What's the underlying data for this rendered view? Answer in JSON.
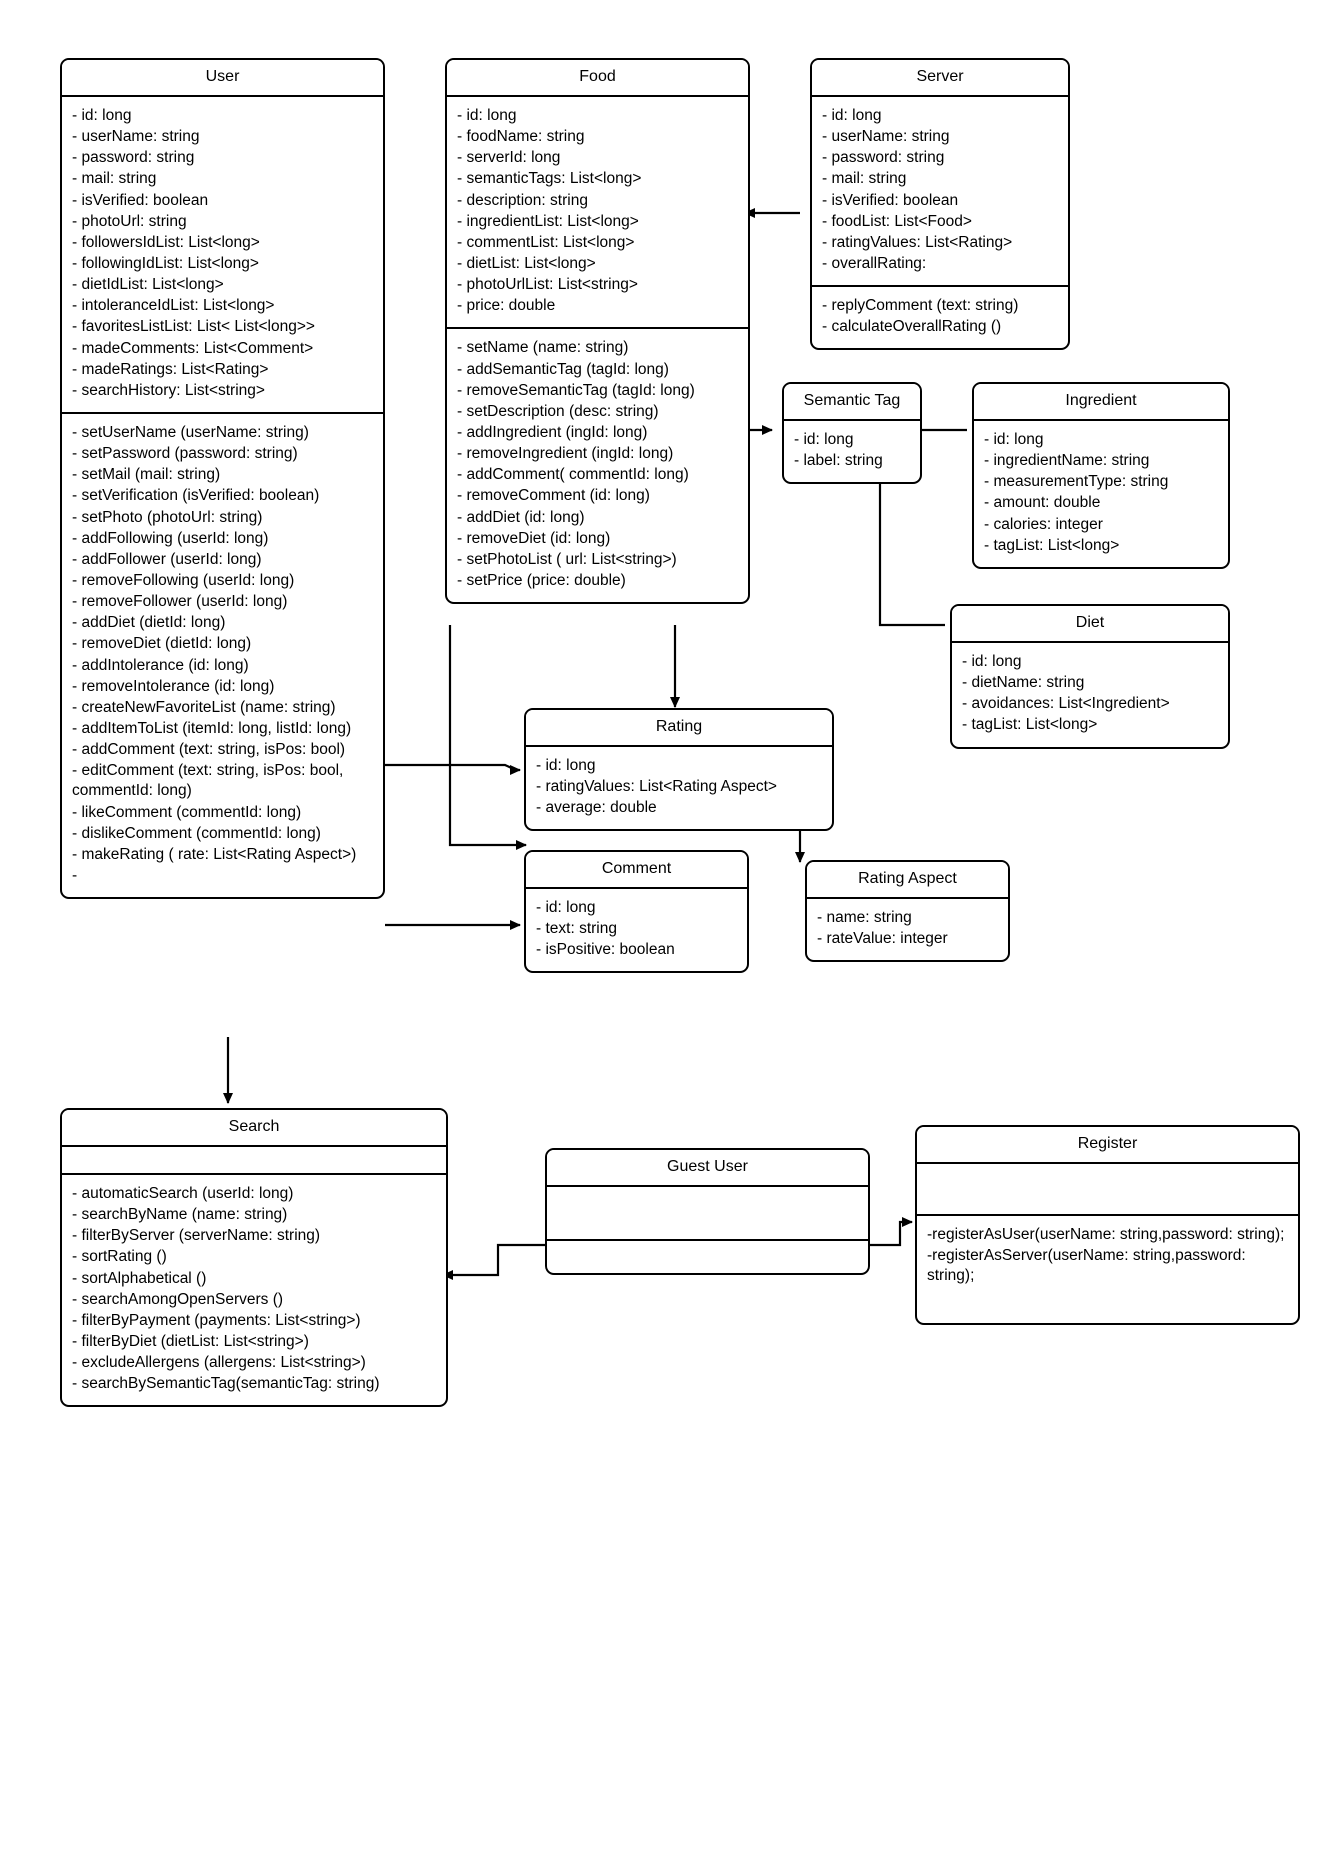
{
  "diagram": {
    "type": "uml-class-diagram",
    "classes": [
      {
        "id": "user",
        "name": "User",
        "attributes": [
          "- id: long",
          "- userName: string",
          "- password: string",
          "- mail: string",
          "- isVerified: boolean",
          "- photoUrl: string",
          "- followersIdList: List<long>",
          "- followingIdList: List<long>",
          "- dietIdList: List<long>",
          "- intoleranceIdList: List<long>",
          "- favoritesListList: List< List<long>>",
          "- madeComments: List<Comment>",
          "- madeRatings: List<Rating>",
          "- searchHistory: List<string>"
        ],
        "methods": [
          "- setUserName (userName: string)",
          "- setPassword (password: string)",
          "- setMail (mail: string)",
          "- setVerification (isVerified: boolean)",
          "- setPhoto (photoUrl: string)",
          "- addFollowing (userId: long)",
          "- addFollower (userId: long)",
          "- removeFollowing (userId: long)",
          "- removeFollower (userId: long)",
          "- addDiet (dietId: long)",
          "- removeDiet (dietId: long)",
          "- addIntolerance (id: long)",
          "- removeIntolerance (id: long)",
          "- createNewFavoriteList (name: string)",
          "- addItemToList (itemId: long, listId: long)",
          "- addComment (text: string, isPos: bool)",
          "- editComment (text: string, isPos: bool, commentId: long)",
          "- likeComment (commentId: long)",
          "- dislikeComment (commentId: long)",
          "- makeRating ( rate: List<Rating Aspect>)",
          "-"
        ]
      },
      {
        "id": "food",
        "name": "Food",
        "attributes": [
          "- id: long",
          "- foodName: string",
          "- serverId: long",
          "- semanticTags: List<long>",
          "- description: string",
          "- ingredientList: List<long>",
          "- commentList: List<long>",
          "- dietList: List<long>",
          "- photoUrlList: List<string>",
          "- price: double"
        ],
        "methods": [
          "- setName (name: string)",
          "- addSemanticTag (tagId: long)",
          "- removeSemanticTag (tagId: long)",
          "- setDescription (desc: string)",
          "- addIngredient (ingId: long)",
          "- removeIngredient (ingId: long)",
          "- addComment( commentId: long)",
          "- removeComment (id: long)",
          "- addDiet (id: long)",
          "- removeDiet (id: long)",
          "- setPhotoList ( url: List<string>)",
          "- setPrice (price: double)"
        ]
      },
      {
        "id": "server",
        "name": "Server",
        "attributes": [
          "- id: long",
          "- userName: string",
          "- password: string",
          "- mail: string",
          "- isVerified: boolean",
          "- foodList: List<Food>",
          "- ratingValues: List<Rating>",
          "- overallRating:"
        ],
        "methods": [
          "- replyComment (text: string)",
          "- calculateOverallRating ()"
        ]
      },
      {
        "id": "semantic-tag",
        "name": "Semantic Tag",
        "attributes": [
          "- id: long",
          "- label: string"
        ],
        "methods": []
      },
      {
        "id": "ingredient",
        "name": "Ingredient",
        "attributes": [
          "- id: long",
          "-  ingredientName: string",
          "-  measurementType: string",
          "-  amount: double",
          "-  calories: integer",
          "-  tagList: List<long>"
        ],
        "methods": []
      },
      {
        "id": "diet",
        "name": "Diet",
        "attributes": [
          "- id: long",
          "- dietName: string",
          "- avoidances: List<Ingredient>",
          "- tagList: List<long>"
        ],
        "methods": []
      },
      {
        "id": "rating",
        "name": "Rating",
        "attributes": [
          "- id: long",
          "- ratingValues: List<Rating Aspect>",
          "- average: double"
        ],
        "methods": []
      },
      {
        "id": "comment",
        "name": "Comment",
        "attributes": [
          "- id: long",
          "- text: string",
          "- isPositive: boolean"
        ],
        "methods": []
      },
      {
        "id": "rating-aspect",
        "name": "Rating Aspect",
        "attributes": [
          "- name: string",
          "- rateValue: integer"
        ],
        "methods": []
      },
      {
        "id": "search",
        "name": "Search",
        "attributes": [],
        "methods": [
          "- automaticSearch (userId: long)",
          "- searchByName (name: string)",
          "- filterByServer (serverName: string)",
          "- sortRating ()",
          "- sortAlphabetical ()",
          "- searchAmongOpenServers ()",
          "- filterByPayment (payments: List<string>)",
          "- filterByDiet (dietList: List<string>)",
          "- excludeAllergens (allergens: List<string>)",
          "- searchBySemanticTag(semanticTag: string)"
        ]
      },
      {
        "id": "guest-user",
        "name": "Guest User",
        "attributes": [],
        "methods": []
      },
      {
        "id": "register",
        "name": "Register",
        "attributes": [],
        "methods": [
          "-registerAsUser(userName: string,password: string);",
          "-registerAsServer(userName: string,password: string);"
        ]
      }
    ]
  }
}
